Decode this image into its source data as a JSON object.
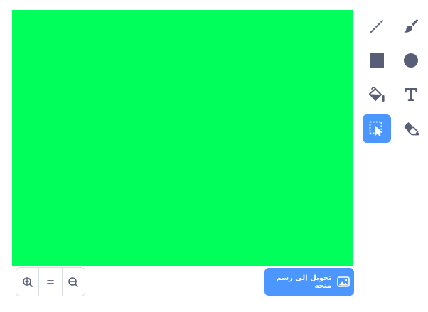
{
  "canvas": {
    "background_color": "#00ff5a"
  },
  "zoom": {
    "zoom_in_icon": "zoom-in-icon",
    "reset_icon": "equals-icon",
    "zoom_out_icon": "zoom-out-icon"
  },
  "convert_button": {
    "label": "تحويل إلى رسم متجه",
    "icon": "image-icon"
  },
  "tools": [
    {
      "name": "line",
      "icon": "line-icon",
      "selected": false
    },
    {
      "name": "brush",
      "icon": "brush-icon",
      "selected": false
    },
    {
      "name": "rectangle",
      "icon": "rectangle-icon",
      "selected": false
    },
    {
      "name": "circle",
      "icon": "circle-icon",
      "selected": false
    },
    {
      "name": "fill",
      "icon": "fill-bucket-icon",
      "selected": false
    },
    {
      "name": "text",
      "icon": "text-icon",
      "selected": false
    },
    {
      "name": "select",
      "icon": "select-icon",
      "selected": true
    },
    {
      "name": "eraser",
      "icon": "eraser-icon",
      "selected": false
    }
  ],
  "colors": {
    "accent": "#4c97ff",
    "icon": "#575e75",
    "border": "#d9dde6"
  }
}
